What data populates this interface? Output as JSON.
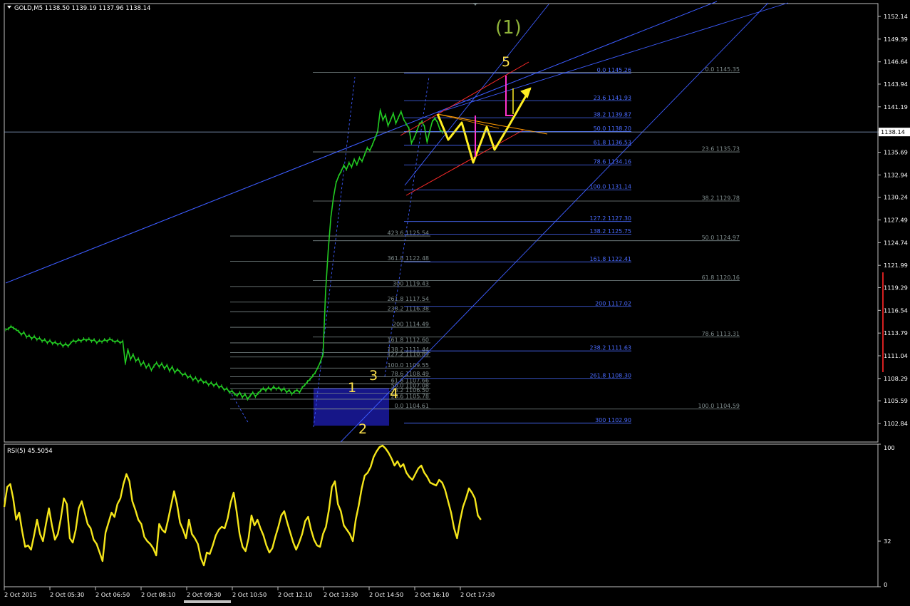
{
  "chart_data": [
    {
      "type": "line",
      "title": "GOLD,M5  1138.50 1139.19 1137.96 1138.14",
      "symbol": "GOLD,M5",
      "ohlc": {
        "open": 1138.5,
        "high": 1139.19,
        "low": 1137.96,
        "close": 1138.14
      },
      "current_price": 1138.14,
      "y_ticks": [
        1152.14,
        1149.39,
        1146.64,
        1143.94,
        1141.19,
        1138.14,
        1135.69,
        1132.94,
        1130.24,
        1127.49,
        1124.74,
        1121.99,
        1119.29,
        1116.54,
        1113.79,
        1111.04,
        1108.29,
        1105.59,
        1102.84
      ],
      "ylim": [
        1102.84,
        1153.3
      ],
      "x_ticks": [
        "2 Oct 2015",
        "2 Oct 05:30",
        "2 Oct 06:50",
        "2 Oct 08:10",
        "2 Oct 09:30",
        "2 Oct 10:50",
        "2 Oct 12:10",
        "2 Oct 13:30",
        "2 Oct 14:50",
        "2 Oct 16:10",
        "2 Oct 17:30"
      ],
      "series": [
        {
          "values": [
            1114.2,
            1114.3,
            1114.6,
            1114.4,
            1114.2,
            1114.0,
            1113.6,
            1113.9,
            1113.3,
            1113.5,
            1113.1,
            1113.4,
            1113.0,
            1113.2,
            1112.8,
            1113.0,
            1112.6,
            1112.9,
            1112.5,
            1112.7,
            1112.4,
            1112.6,
            1112.2,
            1112.5,
            1112.2,
            1112.6,
            1112.9,
            1112.7,
            1113.0,
            1112.8,
            1113.1,
            1112.9,
            1113.1,
            1112.8,
            1113.0,
            1112.6,
            1112.9,
            1112.7,
            1113.0,
            1112.8,
            1113.1,
            1112.9,
            1112.7,
            1112.9,
            1112.6,
            1112.8,
            1110.1,
            1111.8,
            1110.6,
            1111.2,
            1110.4,
            1110.7,
            1109.9,
            1110.3,
            1109.6,
            1110.0,
            1109.3,
            1109.8,
            1110.2,
            1109.7,
            1110.1,
            1109.5,
            1109.9,
            1109.2,
            1109.7,
            1109.0,
            1109.4,
            1109.1,
            1108.7,
            1108.9,
            1108.4,
            1108.6,
            1108.1,
            1108.4,
            1107.9,
            1108.2,
            1107.8,
            1107.9,
            1107.5,
            1107.8,
            1107.4,
            1107.7,
            1107.2,
            1107.4,
            1106.9,
            1107.1,
            1106.6,
            1106.8,
            1106.4,
            1106.2,
            1106.6,
            1106.0,
            1106.4,
            1105.8,
            1106.2,
            1106.6,
            1106.1,
            1106.5,
            1106.8,
            1107.1,
            1106.8,
            1107.2,
            1106.9,
            1107.3,
            1107.0,
            1107.2,
            1106.8,
            1107.1,
            1106.6,
            1106.9,
            1106.4,
            1106.7,
            1106.9,
            1106.6,
            1107.2,
            1107.5,
            1107.9,
            1108.2,
            1108.6,
            1109.0,
            1109.6,
            1110.3,
            1111.2,
            1118.8,
            1123.8,
            1127.8,
            1130.2,
            1132.0,
            1132.8,
            1133.4,
            1134.1,
            1133.6,
            1134.4,
            1133.9,
            1134.8,
            1134.2,
            1135.0,
            1134.6,
            1135.4,
            1136.2,
            1135.9,
            1136.6,
            1137.4,
            1138.2,
            1140.8,
            1139.6,
            1140.2,
            1138.9,
            1139.6,
            1140.4,
            1139.2,
            1139.9,
            1140.6,
            1139.7,
            1139.1,
            1138.6,
            1136.8,
            1137.4,
            1138.2,
            1139.1,
            1139.4,
            1138.8,
            1136.9,
            1138.2,
            1139.4,
            1139.8,
            1139.3,
            1138.4,
            1138.1
          ]
        }
      ]
    },
    {
      "type": "line",
      "title": "RSI(5) 45.5054",
      "y_ticks": [
        100,
        32,
        0
      ],
      "ylim": [
        0,
        100
      ],
      "series": [
        {
          "values": [
            56,
            70,
            72,
            62,
            47,
            52,
            39,
            28,
            29,
            26,
            36,
            47,
            37,
            32,
            44,
            55,
            43,
            33,
            37,
            48,
            62,
            58,
            34,
            31,
            40,
            55,
            60,
            52,
            44,
            41,
            33,
            30,
            24,
            18,
            38,
            45,
            52,
            49,
            58,
            62,
            72,
            79,
            74,
            60,
            54,
            47,
            44,
            35,
            32,
            30,
            27,
            22,
            44,
            40,
            38,
            47,
            57,
            67,
            58,
            45,
            40,
            34,
            47,
            37,
            34,
            30,
            20,
            15,
            24,
            23,
            29,
            36,
            40,
            42,
            41,
            48,
            59,
            66,
            53,
            37,
            28,
            25,
            34,
            50,
            43,
            47,
            41,
            36,
            29,
            24,
            27,
            35,
            42,
            50,
            53,
            45,
            38,
            31,
            26,
            31,
            37,
            46,
            49,
            40,
            33,
            29,
            28,
            37,
            42,
            54,
            70,
            74,
            58,
            53,
            43,
            40,
            37,
            32,
            47,
            57,
            69,
            78,
            80,
            84,
            91,
            95,
            98,
            99,
            97,
            94,
            90,
            85,
            88,
            84,
            86,
            80,
            77,
            75,
            79,
            83,
            85,
            80,
            77,
            73,
            72,
            71,
            75,
            73,
            68,
            60,
            52,
            41,
            34,
            46,
            56,
            62,
            69,
            66,
            62,
            50,
            47
          ]
        }
      ]
    }
  ],
  "annotations": {
    "wave_big": "(1)",
    "wave_labels": [
      "1",
      "2",
      "3",
      "4",
      "5"
    ],
    "fib_blue": [
      {
        "label": "0.0  1145.26",
        "price": 1145.26
      },
      {
        "label": "23.6  1141.93",
        "price": 1141.93
      },
      {
        "label": "38.2  1139.87",
        "price": 1139.87
      },
      {
        "label": "50.0  1138.20",
        "price": 1138.2
      },
      {
        "label": "61.8  1136.53",
        "price": 1136.53
      },
      {
        "label": "78.6  1134.16",
        "price": 1134.16
      },
      {
        "label": "100.0  1131.14",
        "price": 1131.14
      },
      {
        "label": "127.2  1127.30",
        "price": 1127.3
      },
      {
        "label": "138.2  1125.75",
        "price": 1125.75
      },
      {
        "label": "161.8  1122.41",
        "price": 1122.41
      },
      {
        "label": "200  1117.02",
        "price": 1117.02
      },
      {
        "label": "238.2  1111.63",
        "price": 1111.63
      },
      {
        "label": "261.8  1108.30",
        "price": 1108.3
      },
      {
        "label": "300  1102.90",
        "price": 1102.9
      }
    ],
    "fib_gray_right": [
      {
        "label": "0.0  1145.35",
        "price": 1145.35
      },
      {
        "label": "23.6  1135.73",
        "price": 1135.73
      },
      {
        "label": "38.2  1129.78",
        "price": 1129.78
      },
      {
        "label": "50.0  1124.97",
        "price": 1124.97
      },
      {
        "label": "61.8  1120.16",
        "price": 1120.16
      },
      {
        "label": "78.6  1113.31",
        "price": 1113.31
      },
      {
        "label": "100.0  1104.59",
        "price": 1104.59
      }
    ],
    "fib_gray_mid": [
      {
        "label": "423.6  1125.54",
        "price": 1125.54
      },
      {
        "label": "361.8  1122.48",
        "price": 1122.48
      },
      {
        "label": "300  1119.43",
        "price": 1119.43
      },
      {
        "label": "261.8  1117.54",
        "price": 1117.54
      },
      {
        "label": "238.2  1116.38",
        "price": 1116.38
      },
      {
        "label": "200  1114.49",
        "price": 1114.49
      },
      {
        "label": "161.8  1112.60",
        "price": 1112.6
      },
      {
        "label": "138.2  1111.44",
        "price": 1111.44
      },
      {
        "label": "127.2  1110.89",
        "price": 1110.89
      },
      {
        "label": "100.0  1109.55",
        "price": 1109.55
      },
      {
        "label": "78.6  1108.49",
        "price": 1108.49
      },
      {
        "label": "61.8  1107.66",
        "price": 1107.66
      },
      {
        "label": "50.0  1107.08",
        "price": 1107.08
      },
      {
        "label": "38.2  1106.50",
        "price": 1106.5
      },
      {
        "label": "23.6  1105.78",
        "price": 1105.78
      },
      {
        "label": "0.0  1104.61",
        "price": 1104.61
      }
    ]
  },
  "colors": {
    "background": "#000000",
    "grid_frame": "#c0c0c0",
    "price_line": "#22cc22",
    "rsi_line": "#f5e61a",
    "fib_blue": "#4a6bff",
    "fib_gray": "#7f8c8d",
    "trend_line": "#3d5cff",
    "wedge_red": "#ff2a2a",
    "arrow_yellow": "#ffee22",
    "magenta": "#ff33cc",
    "wave_big_color": "#8fb33a",
    "wave_label_color": "#ffe34d",
    "highlight_box": "#1a1aa0",
    "price_tag_bg": "#ffffff",
    "red_marker": "#d42020",
    "axis_text": "#ffffff"
  }
}
